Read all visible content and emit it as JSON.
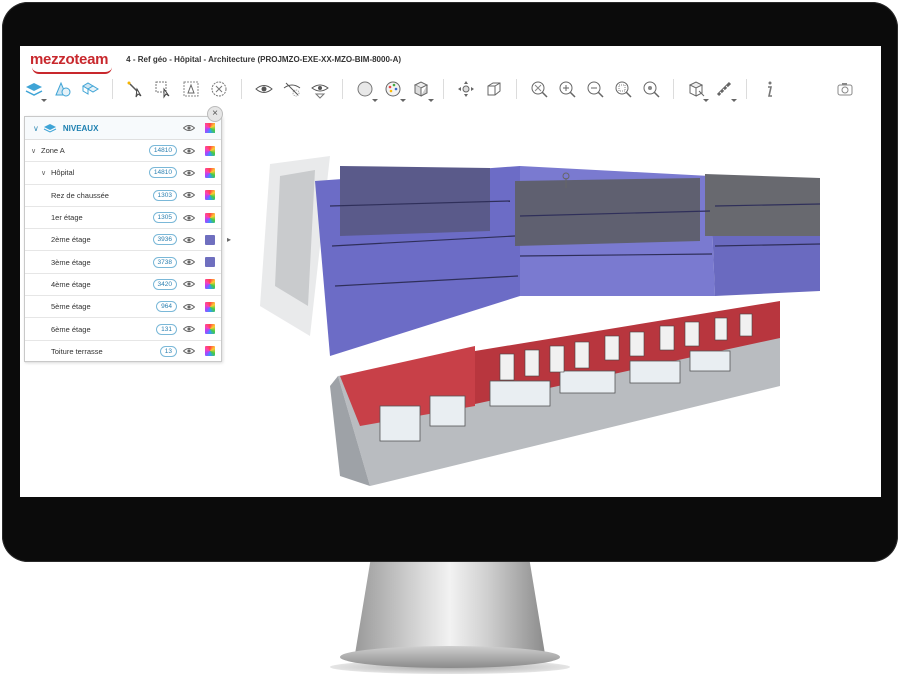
{
  "header": {
    "logo": "mezzoteam",
    "title": "4 - Ref géo - Hôpital - Architecture (PROJMZO-EXE-XX-MZO-BIM-8000-A)"
  },
  "toolbar": {
    "icons": [
      "layers-icon",
      "shapes-icon",
      "cubes-icon",
      "magic-wand-icon",
      "select-box-icon",
      "select-filter-icon",
      "clear-selection-icon",
      "eye-icon",
      "hide-icon",
      "isolate-icon",
      "sphere-icon",
      "palette-icon",
      "section-box-icon",
      "navigate-icon",
      "cube-view-icon",
      "zoom-fit-icon",
      "zoom-in-icon",
      "zoom-out-icon",
      "zoom-window-icon",
      "zoom-selection-icon",
      "measure-box-icon",
      "ruler-icon",
      "info-icon",
      "camera-icon"
    ]
  },
  "panel": {
    "title": "NIVEAUX",
    "rows": [
      {
        "label": "Zone A",
        "count": "14810",
        "indent": "zone",
        "swatch": "rainbow"
      },
      {
        "label": "Hôpital",
        "count": "14810",
        "indent": "building",
        "swatch": "rainbow"
      },
      {
        "label": "Rez de chaussée",
        "count": "1303",
        "indent": "level",
        "swatch": "rainbow"
      },
      {
        "label": "1er étage",
        "count": "1305",
        "indent": "level",
        "swatch": "rainbow"
      },
      {
        "label": "2ème étage",
        "count": "3936",
        "indent": "level",
        "swatch": "purple"
      },
      {
        "label": "3ème étage",
        "count": "3738",
        "indent": "level",
        "swatch": "purple"
      },
      {
        "label": "4ème étage",
        "count": "3420",
        "indent": "level",
        "swatch": "rainbow"
      },
      {
        "label": "5ème étage",
        "count": "964",
        "indent": "level",
        "swatch": "rainbow"
      },
      {
        "label": "6ème étage",
        "count": "131",
        "indent": "level",
        "swatch": "rainbow"
      },
      {
        "label": "Toiture terrasse",
        "count": "13",
        "indent": "level",
        "swatch": "rainbow"
      }
    ]
  },
  "colors": {
    "brand": "#c8282d",
    "accent": "#1c7fb0",
    "highlight_purple": "#6f6fbf",
    "facade_red": "#b8363e",
    "facade_grey": "#8a8f96"
  }
}
